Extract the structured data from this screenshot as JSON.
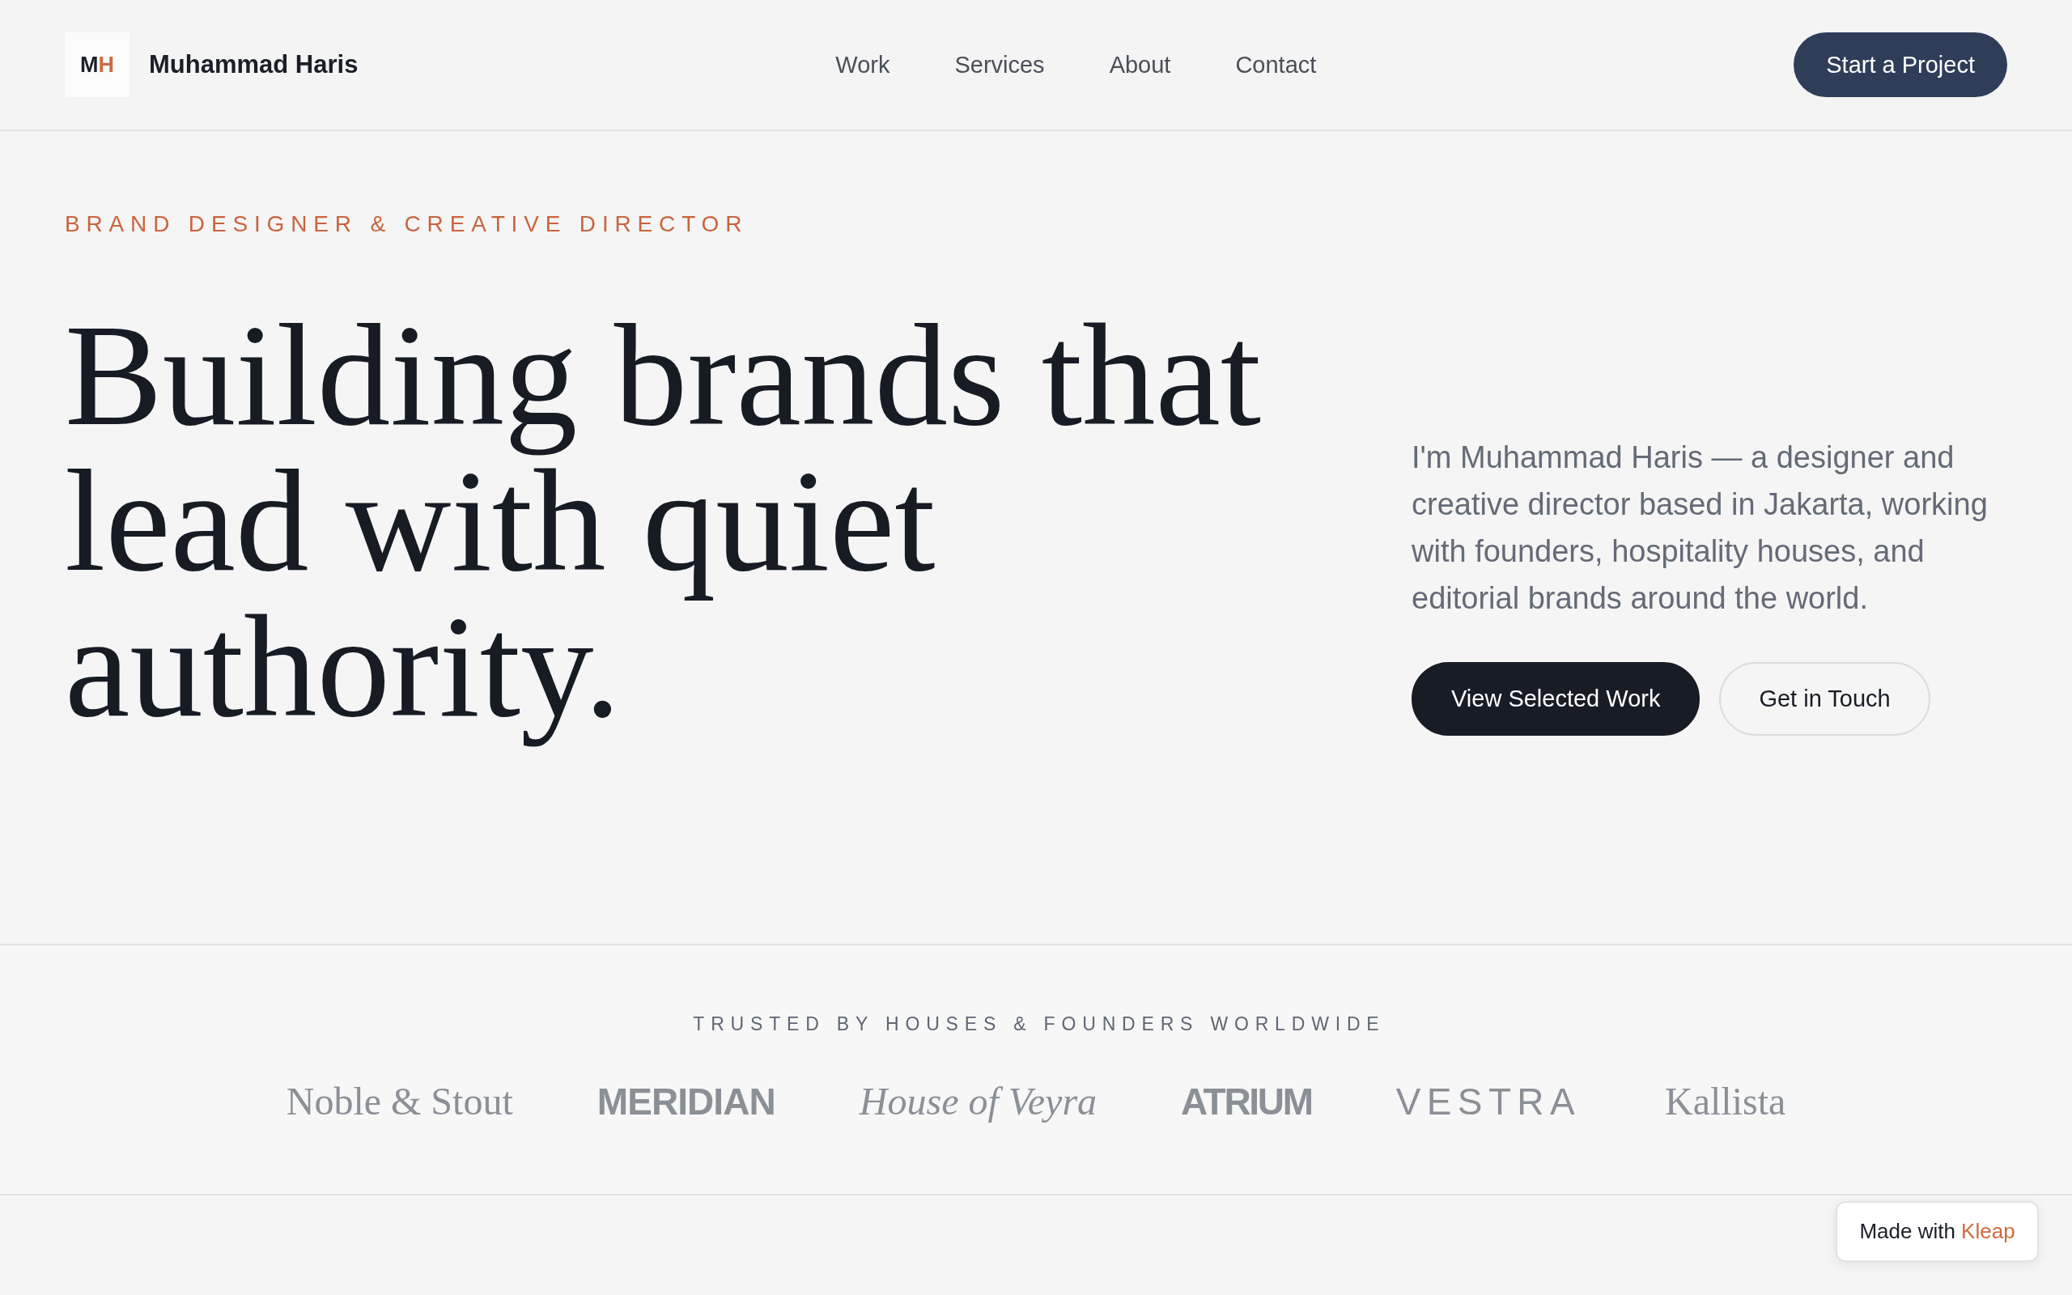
{
  "header": {
    "logo": {
      "mark": [
        {
          "letter": "M",
          "color": "#1b1f29"
        },
        {
          "letter": "H",
          "color": "#cf6a3f"
        }
      ],
      "name": "Muhammad Haris"
    },
    "nav": [
      "Work",
      "Services",
      "About",
      "Contact"
    ],
    "cta": "Start a Project"
  },
  "hero": {
    "eyebrow": "BRAND DESIGNER & CREATIVE DIRECTOR",
    "headline": "Building brands that lead with quiet authority.",
    "intro": "I'm Muhammad Haris — a designer and creative director based in Jakarta, working with founders, hospitality houses, and editorial brands around the world.",
    "buttons": [
      {
        "label": "View Selected Work",
        "kind": "primary"
      },
      {
        "label": "Get in Touch",
        "kind": "secondary"
      }
    ]
  },
  "trusted": {
    "title": "TRUSTED BY HOUSES & FOUNDERS WORLDWIDE",
    "logos": [
      {
        "name": "Noble & Stout",
        "kind": "serif"
      },
      {
        "name": "MERIDIAN",
        "kind": "sans-bold"
      },
      {
        "name": "House of Veyra",
        "kind": "serif-italic"
      },
      {
        "name": "ATRIUM",
        "kind": "sans-condensed"
      },
      {
        "name": "VESTRA",
        "kind": "sans-spaced"
      },
      {
        "name": "Kallista",
        "kind": "serif"
      }
    ]
  },
  "badge": {
    "label": "Made with",
    "brand": "Kleap"
  }
}
